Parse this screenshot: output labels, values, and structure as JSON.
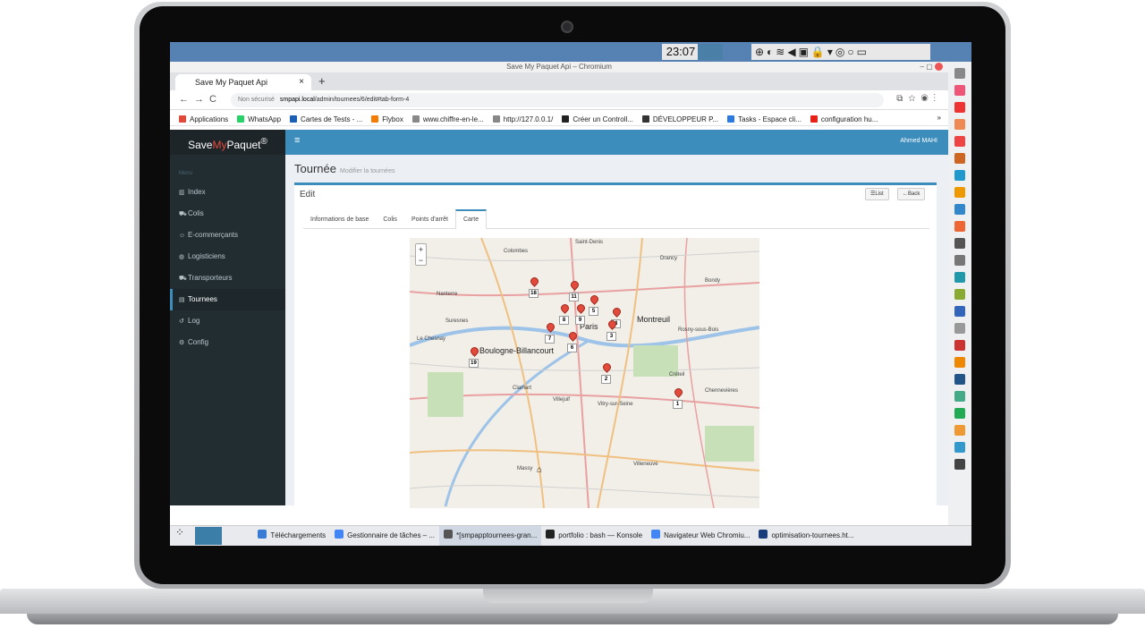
{
  "os": {
    "clock": "23:07"
  },
  "browser": {
    "window_title": "Save My Paquet Api – Chromium",
    "tab_title": "Save My Paquet Api",
    "tab_close": "×",
    "new_tab": "+",
    "security": "Non sécurisé",
    "url_host": "smpapi.local",
    "url_path": "/admin/tournees/6/edit#tab-form-4",
    "bookmarks": [
      {
        "label": "Applications",
        "color": "#e04a3b"
      },
      {
        "label": "WhatsApp",
        "color": "#25d366"
      },
      {
        "label": "Cartes de Tests - ...",
        "color": "#1a5fb4"
      },
      {
        "label": "Flybox",
        "color": "#f57c00"
      },
      {
        "label": "www.chiffre-en-le...",
        "color": "#888888"
      },
      {
        "label": "http://127.0.0.1/",
        "color": "#888888"
      },
      {
        "label": "Créer un Controll...",
        "color": "#222222"
      },
      {
        "label": "DÉVELOPPEUR P...",
        "color": "#333333"
      },
      {
        "label": "Tasks - Espace cli...",
        "color": "#2a7ae2"
      },
      {
        "label": "configuration hu...",
        "color": "#e62117"
      }
    ],
    "bookmarks_more": "»"
  },
  "app": {
    "logo_pre": "Save",
    "logo_my": "My",
    "logo_post": "Paquet",
    "logo_sup": "®",
    "menu_header": "Menu",
    "menu": [
      {
        "label": "Index",
        "icon": "chart-icon"
      },
      {
        "label": "Colis",
        "icon": "cart-icon"
      },
      {
        "label": "E-commerçants",
        "icon": "users-icon"
      },
      {
        "label": "Logisticiens",
        "icon": "globe-icon"
      },
      {
        "label": "Transporteurs",
        "icon": "truck-icon"
      },
      {
        "label": "Tournees",
        "icon": "map-icon"
      },
      {
        "label": "Log",
        "icon": "history-icon"
      },
      {
        "label": "Config",
        "icon": "cogs-icon"
      }
    ],
    "active_menu": "Tournees",
    "user": "Ahmed MAHI",
    "page_title": "Tournée",
    "page_subtitle": "Modifier la tournées",
    "box_title": "Edit",
    "btn_list": "List",
    "btn_back": "Back",
    "tabs": [
      "Informations de base",
      "Colis",
      "Points d'arrêt",
      "Carte"
    ],
    "active_tab": "Carte"
  },
  "map": {
    "zoom_in": "+",
    "zoom_out": "−",
    "markers": [
      "18",
      "11",
      "8",
      "9",
      "5",
      "4",
      "7",
      "6",
      "3",
      "19",
      "2",
      "1"
    ],
    "labels": {
      "paris": "Paris",
      "boulogne": "Boulogne-Billancourt",
      "montreuil": "Montreuil",
      "saint_denis": "Saint-Denis",
      "colombes": "Colombes",
      "nanterre": "Nanterre",
      "vitry": "Vitry-sur-Seine",
      "villejuif": "Villejuif",
      "chenneviers": "Chennevières",
      "villeneuve": "Villeneuve",
      "massy": "Massy",
      "clamart": "Clamart",
      "drancy": "Drancy",
      "bondy": "Bondy",
      "rosny": "Rosny-sous-Bois",
      "creteil": "Créteil",
      "suresnes": "Suresnes",
      "le_chesnay": "Le Chesnay"
    }
  },
  "taskbar": [
    {
      "label": "Téléchargements",
      "color": "#3a7bd5"
    },
    {
      "label": "Gestionnaire de tâches – ...",
      "color": "#4285f4"
    },
    {
      "label": "*[smpapptournees-gran...",
      "color": "#555555"
    },
    {
      "label": "portfolio : bash — Konsole",
      "color": "#222222"
    },
    {
      "label": "Navigateur Web Chromiu...",
      "color": "#4285f4"
    },
    {
      "label": "optimisation-tournees.ht...",
      "color": "#1a3d7c"
    }
  ]
}
